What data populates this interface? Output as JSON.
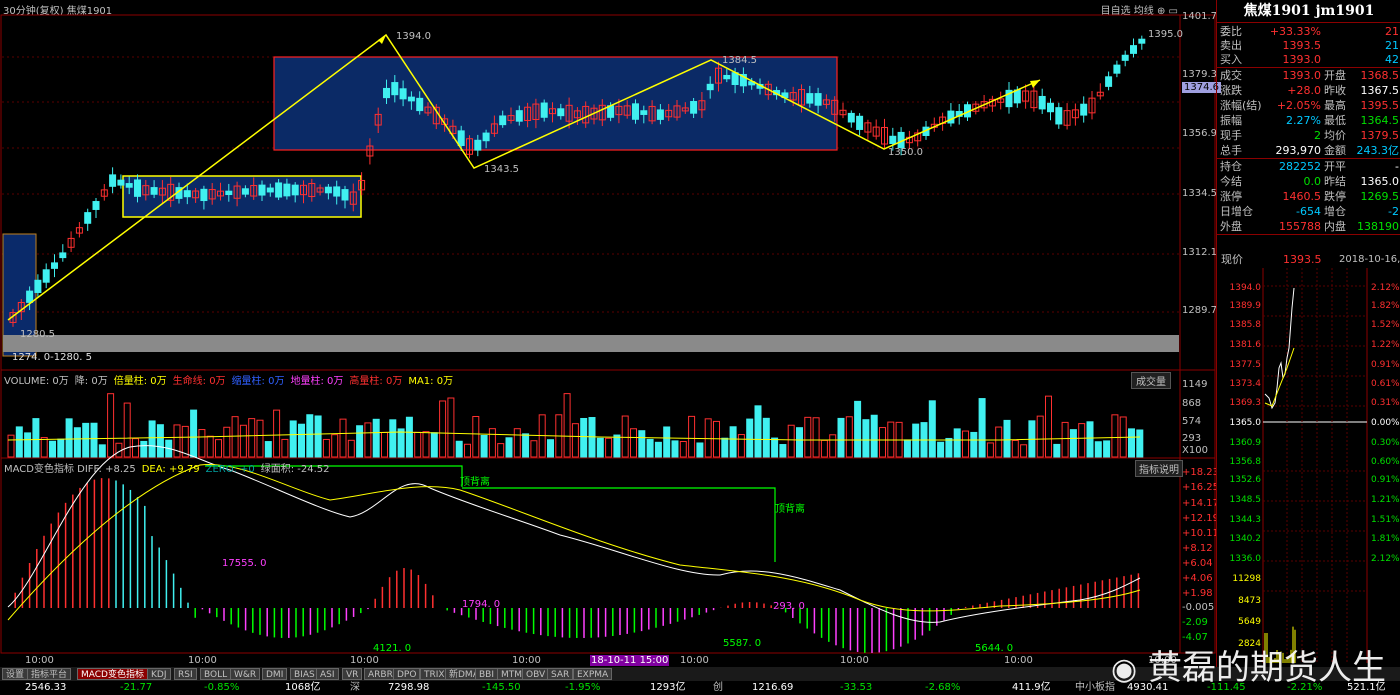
{
  "header": {
    "title": "30分钟(复权)  焦煤1901",
    "tools": "目自选  均线  ⊕  ▭"
  },
  "symbol": {
    "name": "焦煤1901 jm1901"
  },
  "quote": [
    {
      "label": "委比",
      "value": "+33.33%",
      "value_color": "red",
      "label2": "",
      "value2": "21",
      "value2_color": "red"
    },
    {
      "label": "卖出",
      "value": "1393.5",
      "value_color": "red",
      "label2": "",
      "value2": "21",
      "value2_color": "cyan"
    },
    {
      "label": "买入",
      "value": "1393.0",
      "value_color": "red",
      "label2": "",
      "value2": "42",
      "value2_color": "cyan"
    },
    {
      "label": "成交",
      "value": "1393.0",
      "value_color": "red",
      "label2": "开盘",
      "value2": "1368.5",
      "value2_color": "red"
    },
    {
      "label": "涨跌",
      "value": "+28.0",
      "value_color": "red",
      "label2": "昨收",
      "value2": "1367.5",
      "value2_color": "white"
    },
    {
      "label": "涨幅(结)",
      "value": "+2.05%",
      "value_color": "red",
      "label2": "最高",
      "value2": "1395.5",
      "value2_color": "red"
    },
    {
      "label": "振幅",
      "value": "2.27%",
      "value_color": "cyan",
      "label2": "最低",
      "value2": "1364.5",
      "value2_color": "green"
    },
    {
      "label": "现手",
      "value": "2",
      "value_color": "green",
      "label2": "均价",
      "value2": "1379.5",
      "value2_color": "red"
    },
    {
      "label": "总手",
      "value": "293,970",
      "value_color": "white",
      "label2": "金额",
      "value2": "243.3亿",
      "value2_color": "cyan"
    },
    {
      "label": "持仓",
      "value": "282252",
      "value_color": "cyan",
      "label2": "开平",
      "value2": "-",
      "value2_color": "white"
    },
    {
      "label": "今结",
      "value": "0.0",
      "value_color": "green",
      "label2": "昨结",
      "value2": "1365.0",
      "value2_color": "white"
    },
    {
      "label": "涨停",
      "value": "1460.5",
      "value_color": "red",
      "label2": "跌停",
      "value2": "1269.5",
      "value2_color": "green"
    },
    {
      "label": "日增仓",
      "value": "-654",
      "value_color": "cyan",
      "label2": "增仓",
      "value2": "-2",
      "value2_color": "cyan"
    },
    {
      "label": "外盘",
      "value": "155788",
      "value_color": "red",
      "label2": "内盘",
      "value2": "138190",
      "value2_color": "green"
    }
  ],
  "mini": {
    "header_label": "现价",
    "header_value": "1393.5",
    "header_date": "2018-10-16,二",
    "price_ticks": [
      "1394.0",
      "1389.9",
      "1385.8",
      "1381.6",
      "1377.5",
      "1373.4",
      "1369.3",
      "1365.0",
      "1360.9",
      "1356.8",
      "1352.6",
      "1348.5",
      "1344.3",
      "1340.2",
      "1336.0"
    ],
    "pct_ticks": [
      "2.12%",
      "1.82%",
      "1.52%",
      "1.22%",
      "0.91%",
      "0.61%",
      "0.31%",
      "0.00%",
      "0.30%",
      "0.60%",
      "0.91%",
      "1.21%",
      "1.51%",
      "1.81%",
      "2.12%"
    ],
    "vol_ticks": [
      "11298",
      "8473",
      "5649",
      "2824"
    ]
  },
  "price_axis": [
    "1401.7",
    "1379.3",
    "1374.6",
    "1356.9",
    "1334.5",
    "1312.1",
    "1289.7"
  ],
  "annotations": {
    "hi1": "1394.0",
    "hi2": "1384.5",
    "hi3": "1395.0",
    "lo1": "1343.5",
    "lo2": "1350.0",
    "lo0": "1280.5",
    "range": "1274. 0-1280. 5"
  },
  "volume": {
    "legend": [
      {
        "text": "VOLUME: 0万",
        "color": "#c0c0c0"
      },
      {
        "text": "降: 0万",
        "color": "#c0c0c0"
      },
      {
        "text": "倍量柱: 0万",
        "color": "#ffff00"
      },
      {
        "text": "生命线: 0万",
        "color": "#ff3030"
      },
      {
        "text": "缩量柱: 0万",
        "color": "#3060ff"
      },
      {
        "text": "地量柱: 0万",
        "color": "#ff40ff"
      },
      {
        "text": "高量柱: 0万",
        "color": "#ff3030"
      },
      {
        "text": "MA1: 0万",
        "color": "#ffff00"
      }
    ],
    "button": "成交量",
    "ticks": [
      "1149",
      "868",
      "574",
      "293",
      "X100"
    ]
  },
  "macd": {
    "legend": [
      {
        "text": "MACD变色指标  DIFF: +8.25",
        "color": "#c0c0c0"
      },
      {
        "text": "DEA: +9.79",
        "color": "#ffff00"
      },
      {
        "text": "ZERO: +0",
        "color": "#00a0a0"
      },
      {
        "text": "绿面积: -24.52",
        "color": "#c0c0c0"
      }
    ],
    "button": "指标说明",
    "ticks": [
      "+18.23",
      "+16.25",
      "+14.17",
      "+12.19",
      "+10.11",
      "+8.12",
      "+6.04",
      "+4.06",
      "+1.98",
      "-0.005",
      "-2.09",
      "-4.07"
    ],
    "labels": {
      "div1": "顶背离",
      "div2": "顶背离",
      "a1": "17555. 0",
      "a2": "1794. 0",
      "a3": "293. 0",
      "b1": "4121. 0",
      "b2": "5587. 0",
      "b3": "5644. 0"
    }
  },
  "time_axis": [
    "10:00",
    "10:00",
    "10:00",
    "10:00",
    "18-10-11 15:00",
    "10:00",
    "10:00",
    "10:00",
    "10:00"
  ],
  "tabs": [
    "设置",
    "指标平台",
    "MACD变色指标",
    "KDJ",
    "RSI",
    "BOLL",
    "W&R",
    "DMI",
    "BIAS",
    "ASI",
    "VR",
    "ARBR",
    "DPO",
    "TRIX",
    "新DMA",
    "BBI",
    "MTM",
    "OBV",
    "SAR",
    "EXPMA"
  ],
  "status": [
    {
      "text": "2546.33",
      "color": "white"
    },
    {
      "text": "-21.77",
      "color": "green"
    },
    {
      "text": "-0.85%",
      "color": "green"
    },
    {
      "text": "1068亿",
      "color": "white"
    },
    {
      "text": "深",
      "color": "lbl"
    },
    {
      "text": "7298.98",
      "color": "white"
    },
    {
      "text": "-145.50",
      "color": "green"
    },
    {
      "text": "-1.95%",
      "color": "green"
    },
    {
      "text": "1293亿",
      "color": "white"
    },
    {
      "text": "创",
      "color": "lbl"
    },
    {
      "text": "1216.69",
      "color": "white"
    },
    {
      "text": "-33.53",
      "color": "green"
    },
    {
      "text": "-2.68%",
      "color": "green"
    },
    {
      "text": "411.9亿",
      "color": "white"
    },
    {
      "text": "中小板指",
      "color": "lbl"
    },
    {
      "text": "4930.41",
      "color": "white"
    },
    {
      "text": "-111.45",
      "color": "green"
    },
    {
      "text": "-2.21%",
      "color": "green"
    },
    {
      "text": "521.1亿",
      "color": "white"
    }
  ],
  "watermark": "黄磊的期货人生"
}
